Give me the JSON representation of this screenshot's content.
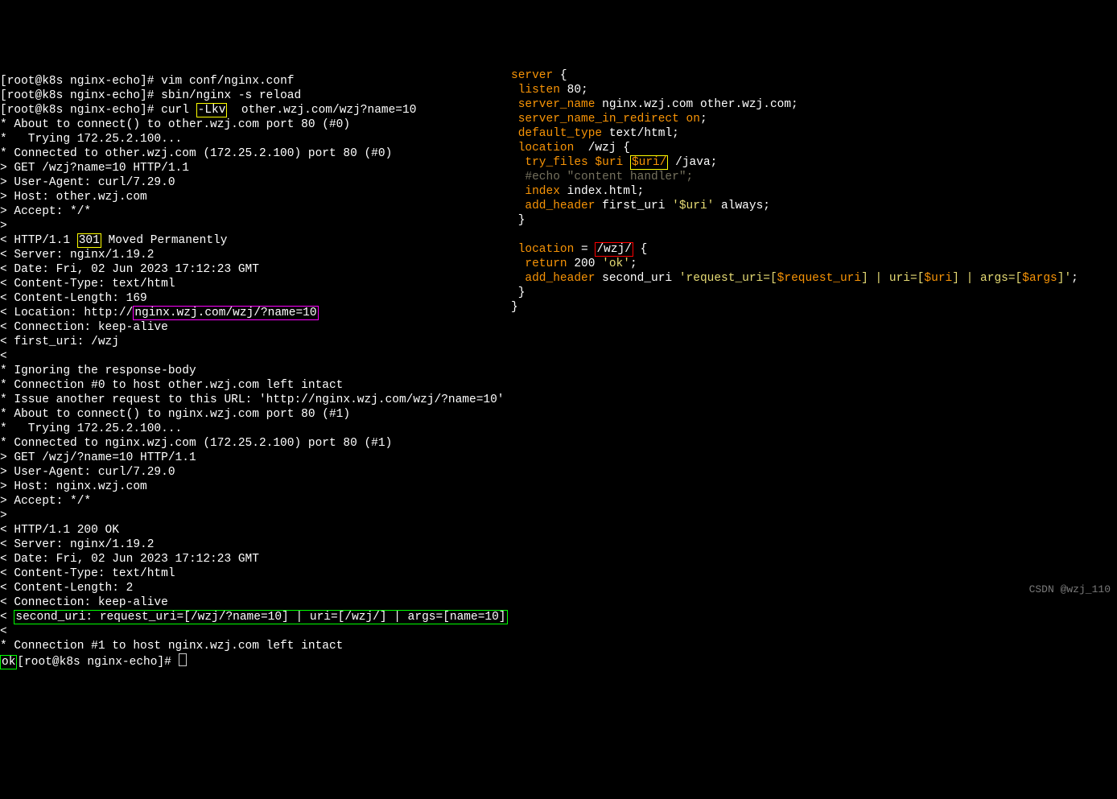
{
  "prompt": {
    "user_host": "[root@k8s nginx-echo]# ",
    "cmd1": "vim conf/nginx.conf",
    "cmd2": "sbin/nginx -s reload",
    "curl": "curl ",
    "flag": "-Lkv",
    "target": "  other.wzj.com/wzj?name=10"
  },
  "left": [
    "* About to connect() to other.wzj.com port 80 (#0)",
    "*   Trying 172.25.2.100...",
    "* Connected to other.wzj.com (172.25.2.100) port 80 (#0)",
    "> GET /wzj?name=10 HTTP/1.1",
    "> User-Agent: curl/7.29.0",
    "> Host: other.wzj.com",
    "> Accept: */*",
    "> "
  ],
  "http301_a": "< HTTP/1.1 ",
  "http301_code": "301",
  "http301_b": " Moved Permanently",
  "left2": [
    "< Server: nginx/1.19.2",
    "< Date: Fri, 02 Jun 2023 17:12:23 GMT",
    "< Content-Type: text/html",
    "< Content-Length: 169"
  ],
  "loc_a": "< Location: http://",
  "loc_b": "nginx.wzj.com/wzj/?name=10",
  "left3": [
    "< Connection: keep-alive",
    "< first_uri: /wzj",
    "< ",
    "* Ignoring the response-body",
    "* Connection #0 to host other.wzj.com left intact",
    "* Issue another request to this URL: 'http://nginx.wzj.com/wzj/?name=10'",
    "* About to connect() to nginx.wzj.com port 80 (#1)",
    "*   Trying 172.25.2.100...",
    "* Connected to nginx.wzj.com (172.25.2.100) port 80 (#1)",
    "> GET /wzj/?name=10 HTTP/1.1",
    "> User-Agent: curl/7.29.0",
    "> Host: nginx.wzj.com",
    "> Accept: */*",
    "> ",
    "< HTTP/1.1 200 OK",
    "< Server: nginx/1.19.2",
    "< Date: Fri, 02 Jun 2023 17:12:23 GMT",
    "< Content-Type: text/html",
    "< Content-Length: 2",
    "< Connection: keep-alive"
  ],
  "second_uri_a": "< ",
  "second_uri_b": "second_uri: request_uri=[/wzj/?name=10] | uri=[/wzj/] | args=[name=10]",
  "left4": [
    "< ",
    "* Connection #1 to host nginx.wzj.com left intact"
  ],
  "ok": "ok",
  "final_prompt": "[root@k8s nginx-echo]# ",
  "conf": {
    "server": "server",
    "brace_open": " {",
    "listen": " listen",
    "port": " 80;",
    "server_name": " server_name",
    "names": " nginx.wzj.com other.wzj.com;",
    "redir": " server_name_in_redirect",
    "on": " on",
    "semi": ";",
    "deftype": " default_type",
    "texthtml": " text/html;",
    "location1": " location",
    "loc1path": "  /wzj {",
    "tryfiles": "  try_files",
    "uri": " $uri",
    "uri_slash": "$uri/",
    "java": " /java;",
    "comment1": "  #echo \"content handler\";",
    "index": "  index",
    "indexval": " index.html;",
    "addh1": "  add_header",
    "first_uri": " first_uri",
    "first_uri_val": " '$uri'",
    "always": " always;",
    "cb1": " }",
    "location2": " location",
    "eq": " = ",
    "wzj_slash": "/wzj/",
    "ob2": " {",
    "return": "  return",
    "r200": " 200 ",
    "ok_q": "'ok'",
    "semi2": ";",
    "addh2": "  add_header",
    "second": " second_uri ",
    "pre_req": "'request_uri=[",
    "req_uri": "$request_uri",
    "mid1": "] | uri=[",
    "svar_uri": "$uri",
    "mid2": "] | args=[",
    "args": "$args",
    "end": "]'",
    "semi3": ";",
    "cb2": " }",
    "cb3": "}"
  },
  "watermark": "CSDN @wzj_110"
}
